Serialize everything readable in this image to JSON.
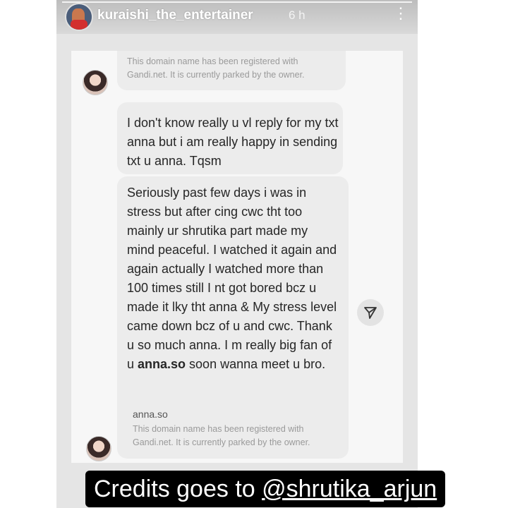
{
  "story": {
    "username": "kuraishi_the_entertainer",
    "time_ago": "6 h",
    "more_icon": "more-vertical-icon"
  },
  "chat": {
    "link_preview_top": {
      "description": "This domain name has been registered with Gandi.net. It is currently parked by the owner."
    },
    "message_1": "I don't know really u vl reply for my txt anna but i am really happy in sending txt u anna. Tqsm",
    "message_2": {
      "text_before": "Seriously past few days i was in stress but after cing cwc tht too mainly ur shrutika part made my mind peaceful. I watched it again and again actually I watched more than 100 times still I nt got bored bcz u made it lky tht anna & My stress level came down bcz of u and cwc. Thank u so much anna. I m really big fan of u ",
      "link_word": "anna.so",
      "text_after": " soon wanna meet u bro.",
      "link_title": "anna.so",
      "link_description": "This domain name has been registered with Gandi.net. It is currently parked by the owner."
    },
    "share_icon": "send-icon"
  },
  "caption": {
    "prefix": "Credits goes to ",
    "mention": "@shrutika_arjun"
  }
}
